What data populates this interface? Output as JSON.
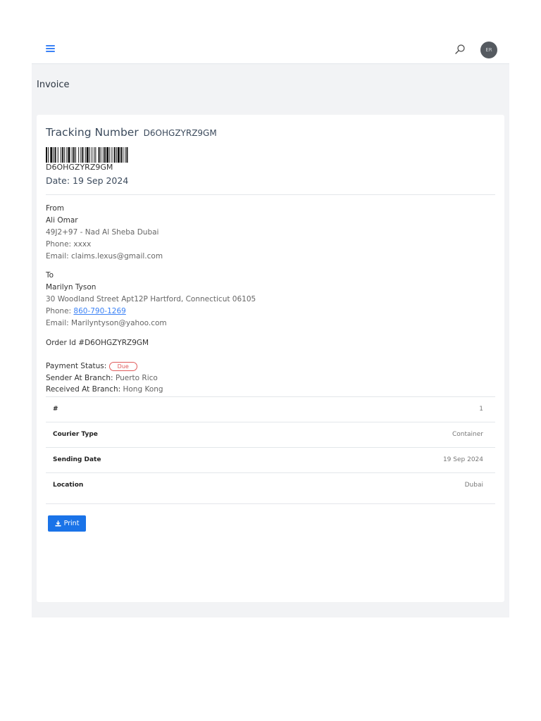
{
  "header": {
    "menu_icon": "hamburger-icon",
    "search_icon": "search-icon",
    "avatar_initials": "ER"
  },
  "page_title": "Invoice",
  "invoice": {
    "tracking_label": "Tracking Number",
    "tracking_number": "D6OHGZYRZ9GM",
    "barcode_text": "D6OHGZYRZ9GM",
    "date_line": "Date: 19 Sep 2024",
    "from": {
      "heading": "From",
      "name": "Ali Omar",
      "address": "49J2+97 - Nad Al Sheba Dubai",
      "phone_label": "Phone:",
      "phone": "xxxx",
      "email_label": "Email:",
      "email": "claims.lexus@gmail.com"
    },
    "to": {
      "heading": "To",
      "name": "Marilyn Tyson",
      "address": "30 Woodland Street Apt12P Hartford, Connecticut 06105",
      "phone_label": "Phone:",
      "phone": "860-790-1269",
      "email_label": "Email:",
      "email": "Marilyntyson@yahoo.com"
    },
    "order_id": "Order Id #D6OHGZYRZ9GM",
    "payment_status_label": "Payment Status:",
    "payment_status": "Due",
    "sender_branch_label": "Sender At Branch:",
    "sender_branch": "Puerto Rico",
    "received_branch_label": "Received At Branch:",
    "received_branch": "Hong Kong",
    "details": [
      {
        "label": "#",
        "value": "1"
      },
      {
        "label": "Courier Type",
        "value": "Container"
      },
      {
        "label": "Sending Date",
        "value": "19 Sep 2024"
      },
      {
        "label": "Location",
        "value": "Dubai"
      }
    ],
    "print_label": "Print"
  },
  "colors": {
    "accent": "#1a73e8",
    "badge_due": "#e05c5c",
    "background": "#f2f3f5"
  }
}
